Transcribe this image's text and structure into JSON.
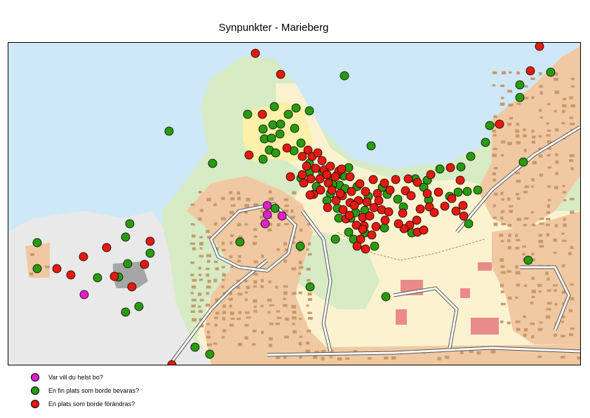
{
  "title": "Synpunkter - Marieberg",
  "colors": {
    "water": "#cfe8f7",
    "greenery": "#d7ebc4",
    "residential": "#f0c9a2",
    "building": "#c8996e",
    "light_zone": "#fbf3cf",
    "park_zone": "#fdf0a8",
    "industrial": "#e9e9e9",
    "large_building": "#a6a6a6",
    "public_building": "#eb8a8a",
    "road": "#ffffff",
    "road_edge": "#555555",
    "path": "#c77a6a"
  },
  "legend": [
    {
      "key": "live",
      "label": "Var vill du helst bo?",
      "color": "#e020c8"
    },
    {
      "key": "preserve",
      "label": "En fin plats som borde bevaras?",
      "color": "#2a9a10"
    },
    {
      "key": "change",
      "label": "En plats som borde förändras?",
      "color": "#e41a10"
    }
  ],
  "points": {
    "live": [
      [
        380,
        292
      ],
      [
        380,
        305
      ],
      [
        401,
        307
      ],
      [
        377,
        318
      ],
      [
        119,
        419
      ]
    ],
    "preserve": [
      [
        490,
        107
      ],
      [
        352,
        162
      ],
      [
        390,
        151
      ],
      [
        421,
        153
      ],
      [
        440,
        157
      ],
      [
        410,
        162
      ],
      [
        388,
        177
      ],
      [
        374,
        183
      ],
      [
        399,
        176
      ],
      [
        419,
        182
      ],
      [
        376,
        197
      ],
      [
        386,
        196
      ],
      [
        398,
        190
      ],
      [
        383,
        213
      ],
      [
        392,
        217
      ],
      [
        374,
        226
      ],
      [
        428,
        203
      ],
      [
        418,
        214
      ],
      [
        240,
        186
      ],
      [
        302,
        232
      ],
      [
        528,
        207
      ],
      [
        784,
        102
      ],
      [
        740,
        120
      ],
      [
        740,
        138
      ],
      [
        697,
        178
      ],
      [
        691,
        202
      ],
      [
        670,
        222
      ],
      [
        656,
        237
      ],
      [
        626,
        240
      ],
      [
        608,
        256
      ],
      [
        591,
        254
      ],
      [
        745,
        230
      ],
      [
        680,
        270
      ],
      [
        665,
        272
      ],
      [
        640,
        279
      ],
      [
        652,
        273
      ],
      [
        603,
        266
      ],
      [
        667,
        318
      ],
      [
        610,
        284
      ],
      [
        574,
        294
      ],
      [
        566,
        283
      ],
      [
        547,
        324
      ],
      [
        533,
        350
      ],
      [
        519,
        331
      ],
      [
        503,
        340
      ],
      [
        499,
        310
      ],
      [
        482,
        310
      ],
      [
        480,
        296
      ],
      [
        470,
        275
      ],
      [
        483,
        263
      ],
      [
        470,
        257
      ],
      [
        459,
        245
      ],
      [
        440,
        245
      ],
      [
        428,
        253
      ],
      [
        496,
        238
      ],
      [
        491,
        268
      ],
      [
        508,
        265
      ],
      [
        489,
        250
      ],
      [
        519,
        299
      ],
      [
        506,
        302
      ],
      [
        544,
        266
      ],
      [
        524,
        279
      ],
      [
        551,
        276
      ],
      [
        440,
        232
      ],
      [
        450,
        265
      ],
      [
        465,
        285
      ],
      [
        496,
        330
      ],
      [
        473,
        262
      ],
      [
        479,
        249
      ],
      [
        586,
        331
      ],
      [
        549,
        422
      ],
      [
        441,
        408
      ],
      [
        427,
        350
      ],
      [
        477,
        340
      ],
      [
        341,
        344
      ],
      [
        391,
        296
      ],
      [
        184,
        318
      ],
      [
        178,
        337
      ],
      [
        52,
        345
      ],
      [
        52,
        382
      ],
      [
        138,
        395
      ],
      [
        168,
        394
      ],
      [
        181,
        375
      ],
      [
        213,
        360
      ],
      [
        197,
        436
      ],
      [
        178,
        444
      ],
      [
        277,
        494
      ],
      [
        298,
        504
      ],
      [
        752,
        370
      ]
    ],
    "change": [
      [
        363,
        75
      ],
      [
        768,
        65
      ],
      [
        399,
        105
      ],
      [
        755,
        100
      ],
      [
        373,
        162
      ],
      [
        711,
        176
      ],
      [
        354,
        220
      ],
      [
        408,
        210
      ],
      [
        438,
        213
      ],
      [
        430,
        222
      ],
      [
        444,
        222
      ],
      [
        452,
        217
      ],
      [
        436,
        236
      ],
      [
        430,
        248
      ],
      [
        442,
        254
      ],
      [
        449,
        239
      ],
      [
        461,
        241
      ],
      [
        470,
        236
      ],
      [
        482,
        243
      ],
      [
        498,
        251
      ],
      [
        486,
        240
      ],
      [
        455,
        254
      ],
      [
        467,
        260
      ],
      [
        472,
        270
      ],
      [
        478,
        285
      ],
      [
        466,
        295
      ],
      [
        488,
        298
      ],
      [
        498,
        288
      ],
      [
        487,
        278
      ],
      [
        500,
        272
      ],
      [
        512,
        261
      ],
      [
        520,
        272
      ],
      [
        510,
        285
      ],
      [
        522,
        287
      ],
      [
        532,
        295
      ],
      [
        543,
        298
      ],
      [
        537,
        275
      ],
      [
        539,
        285
      ],
      [
        531,
        255
      ],
      [
        547,
        260
      ],
      [
        555,
        270
      ],
      [
        563,
        255
      ],
      [
        577,
        271
      ],
      [
        581,
        254
      ],
      [
        594,
        259
      ],
      [
        585,
        278
      ],
      [
        573,
        303
      ],
      [
        598,
        297
      ],
      [
        608,
        275
      ],
      [
        611,
        294
      ],
      [
        618,
        302
      ],
      [
        633,
        293
      ],
      [
        643,
        282
      ],
      [
        649,
        300
      ],
      [
        659,
        292
      ],
      [
        655,
        256
      ],
      [
        660,
        307
      ],
      [
        641,
        238
      ],
      [
        624,
        273
      ],
      [
        613,
        248
      ],
      [
        593,
        313
      ],
      [
        583,
        320
      ],
      [
        594,
        330
      ],
      [
        603,
        327
      ],
      [
        575,
        325
      ],
      [
        567,
        318
      ],
      [
        553,
        301
      ],
      [
        548,
        313
      ],
      [
        535,
        322
      ],
      [
        529,
        334
      ],
      [
        518,
        321
      ],
      [
        516,
        309
      ],
      [
        507,
        320
      ],
      [
        492,
        311
      ],
      [
        504,
        292
      ],
      [
        497,
        306
      ],
      [
        513,
        340
      ],
      [
        520,
        354
      ],
      [
        508,
        350
      ],
      [
        526,
        307
      ],
      [
        484,
        275
      ],
      [
        516,
        326
      ],
      [
        458,
        228
      ],
      [
        477,
        251
      ],
      [
        465,
        248
      ],
      [
        446,
        276
      ],
      [
        456,
        270
      ],
      [
        432,
        260
      ],
      [
        413,
        251
      ],
      [
        441,
        277
      ],
      [
        151,
        352
      ],
      [
        118,
        365
      ],
      [
        80,
        382
      ],
      [
        100,
        391
      ],
      [
        162,
        393
      ],
      [
        205,
        376
      ],
      [
        213,
        343
      ],
      [
        187,
        408
      ],
      [
        244,
        519
      ]
    ]
  }
}
